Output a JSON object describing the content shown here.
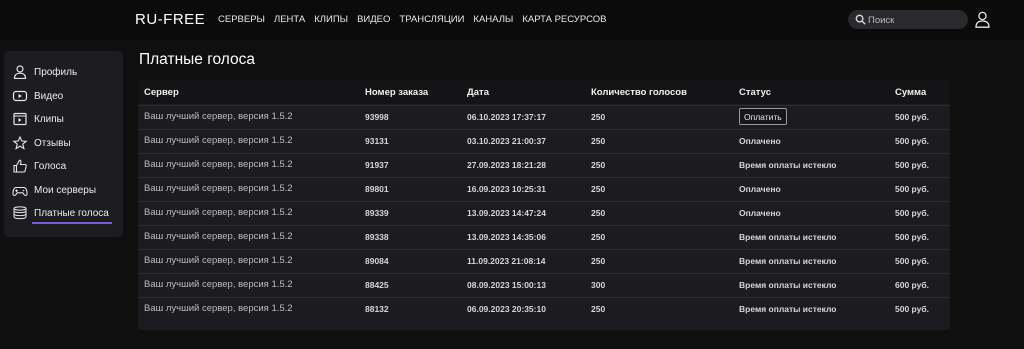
{
  "header": {
    "logo": "RU-FREE",
    "nav": [
      "СЕРВЕРЫ",
      "ЛЕНТА",
      "КЛИПЫ",
      "ВИДЕО",
      "ТРАНСЛЯЦИИ",
      "КАНАЛЫ",
      "КАРТА РЕСУРСОВ"
    ],
    "search_placeholder": "Поиск"
  },
  "sidebar": {
    "items": [
      {
        "label": "Профиль",
        "icon": "user-icon"
      },
      {
        "label": "Видео",
        "icon": "video-icon"
      },
      {
        "label": "Клипы",
        "icon": "clips-icon"
      },
      {
        "label": "Отзывы",
        "icon": "star-icon"
      },
      {
        "label": "Голоса",
        "icon": "thumb-up-icon"
      },
      {
        "label": "Мои серверы",
        "icon": "gamepad-icon"
      },
      {
        "label": "Платные голоса",
        "icon": "coins-icon"
      }
    ],
    "active_index": 6,
    "accent_color": "#7b5cd6"
  },
  "page": {
    "title": "Платные голоса"
  },
  "table": {
    "headers": [
      "Сервер",
      "Номер заказа",
      "Дата",
      "Количество голосов",
      "Статус",
      "Сумма"
    ],
    "pay_button_label": "Оплатить",
    "rows": [
      {
        "server": "Ваш лучший сервер, версия 1.5.2",
        "order": "93998",
        "date": "06.10.2023 17:37:17",
        "votes": "250",
        "status": "Оплатить",
        "sum": "500 руб."
      },
      {
        "server": "Ваш лучший сервер, версия 1.5.2",
        "order": "93131",
        "date": "03.10.2023 21:00:37",
        "votes": "250",
        "status": "Оплачено",
        "sum": "500 руб."
      },
      {
        "server": "Ваш лучший сервер, версия 1.5.2",
        "order": "91937",
        "date": "27.09.2023 18:21:28",
        "votes": "250",
        "status": "Время оплаты истекло",
        "sum": "500 руб."
      },
      {
        "server": "Ваш лучший сервер, версия 1.5.2",
        "order": "89801",
        "date": "16.09.2023 10:25:31",
        "votes": "250",
        "status": "Оплачено",
        "sum": "500 руб."
      },
      {
        "server": "Ваш лучший сервер, версия 1.5.2",
        "order": "89339",
        "date": "13.09.2023 14:47:24",
        "votes": "250",
        "status": "Оплачено",
        "sum": "500 руб."
      },
      {
        "server": "Ваш лучший сервер, версия 1.5.2",
        "order": "89338",
        "date": "13.09.2023 14:35:06",
        "votes": "250",
        "status": "Время оплаты истекло",
        "sum": "500 руб."
      },
      {
        "server": "Ваш лучший сервер, версия 1.5.2",
        "order": "89084",
        "date": "11.09.2023 21:08:14",
        "votes": "250",
        "status": "Время оплаты истекло",
        "sum": "500 руб."
      },
      {
        "server": "Ваш лучший сервер, версия 1.5.2",
        "order": "88425",
        "date": "08.09.2023 15:00:13",
        "votes": "300",
        "status": "Время оплаты истекло",
        "sum": "600 руб."
      },
      {
        "server": "Ваш лучший сервер, версия 1.5.2",
        "order": "88132",
        "date": "06.09.2023 20:35:10",
        "votes": "250",
        "status": "Время оплаты истекло",
        "sum": "500 руб."
      }
    ]
  }
}
